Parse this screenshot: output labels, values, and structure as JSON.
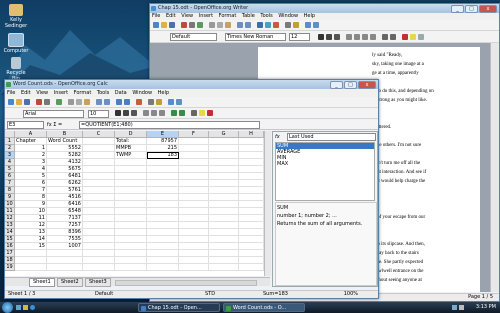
{
  "desktop": {
    "icons": [
      {
        "label": "Kelly\nSedinger",
        "icon": "user-folder-icon"
      },
      {
        "label": "Computer",
        "icon": "computer-icon"
      },
      {
        "label": "Recycle Bin",
        "icon": "recycle-bin-icon"
      }
    ]
  },
  "writer": {
    "title": "Chap 15.odt - OpenOffice.org Writer",
    "menu": [
      "File",
      "Edit",
      "View",
      "Insert",
      "Format",
      "Table",
      "Tools",
      "Window",
      "Help"
    ],
    "style_value": "Default",
    "font_value": "Times New Roman",
    "size_value": "12",
    "text_lines": [
      "ly said \"Ready,",
      "sky, taking one image at a",
      "ge at a time, apparently",
      "",
      "in to do this, and depending on",
      "as strong as you might like.",
      "",
      "",
      "shattered.",
      "",
      "e the others. I'm not sure",
      "",
      "Don't turn me off all the",
      "hout interaction. And see if",
      "ight would help charge the",
      "",
      "",
      "",
      "ar of your escape from our",
      "",
      "",
      "it to its slipcase. And then,",
      "e way back to the stairs",
      "ouse. She partly expected",
      "crawlwell entrance on the",
      "without seeing anyone at"
    ],
    "page_label": "Page 1 / 5"
  },
  "calc": {
    "title": "Word Count.ods - OpenOffice.org Calc",
    "menu": [
      "File",
      "Edit",
      "View",
      "Insert",
      "Format",
      "Tools",
      "Data",
      "Window",
      "Help"
    ],
    "font_value": "Arial",
    "size_value": "10",
    "name_box": "E3",
    "formula_icons": "fx Σ =",
    "formula": "=QUOTIENT(E1;480)",
    "columns": [
      "A",
      "B",
      "C",
      "D",
      "E",
      "F",
      "G",
      "H"
    ],
    "rows": [
      {
        "n": "1",
        "a": "Chapter",
        "b": "Word Count",
        "d": "Total:",
        "e": "87957"
      },
      {
        "n": "2",
        "a": "1",
        "b": "5552",
        "d": "MMPB",
        "e": "215"
      },
      {
        "n": "3",
        "a": "2",
        "b": "5282",
        "d": "TWMP",
        "e": "183"
      },
      {
        "n": "4",
        "a": "3",
        "b": "4132",
        "d": "",
        "e": ""
      },
      {
        "n": "5",
        "a": "4",
        "b": "5675",
        "d": "",
        "e": ""
      },
      {
        "n": "6",
        "a": "5",
        "b": "6481",
        "d": "",
        "e": ""
      },
      {
        "n": "7",
        "a": "6",
        "b": "6262",
        "d": "",
        "e": ""
      },
      {
        "n": "8",
        "a": "7",
        "b": "5761",
        "d": "",
        "e": ""
      },
      {
        "n": "9",
        "a": "8",
        "b": "4516",
        "d": "",
        "e": ""
      },
      {
        "n": "10",
        "a": "9",
        "b": "6416",
        "d": "",
        "e": ""
      },
      {
        "n": "11",
        "a": "10",
        "b": "6548",
        "d": "",
        "e": ""
      },
      {
        "n": "12",
        "a": "11",
        "b": "7137",
        "d": "",
        "e": ""
      },
      {
        "n": "13",
        "a": "12",
        "b": "7257",
        "d": "",
        "e": ""
      },
      {
        "n": "14",
        "a": "13",
        "b": "8396",
        "d": "",
        "e": ""
      },
      {
        "n": "15",
        "a": "14",
        "b": "7535",
        "d": "",
        "e": ""
      },
      {
        "n": "16",
        "a": "15",
        "b": "1007",
        "d": "",
        "e": ""
      },
      {
        "n": "17",
        "a": "",
        "b": "",
        "d": "",
        "e": ""
      },
      {
        "n": "18",
        "a": "",
        "b": "",
        "d": "",
        "e": ""
      },
      {
        "n": "19",
        "a": "",
        "b": "",
        "d": "",
        "e": ""
      }
    ],
    "sheet_tabs": [
      "Sheet1",
      "Sheet2",
      "Sheet3"
    ],
    "functions_panel": {
      "category": "Last Used",
      "list": [
        "SUM",
        "AVERAGE",
        "MIN",
        "MAX"
      ],
      "signature": "SUM",
      "args": "number 1; number 2; ...",
      "description": "Returns the sum of all arguments."
    },
    "status": {
      "sheet": "Sheet 1 / 3",
      "style": "Default",
      "mode": "STD",
      "sum": "Sum=183",
      "zoom": "100%"
    }
  },
  "taskbar": {
    "buttons": [
      {
        "label": "Chap 15.odt - Open...",
        "color": "#3f7fc6"
      },
      {
        "label": "Word Count.ods - O...",
        "color": "#3aa047"
      }
    ],
    "clock": "3:13 PM"
  }
}
